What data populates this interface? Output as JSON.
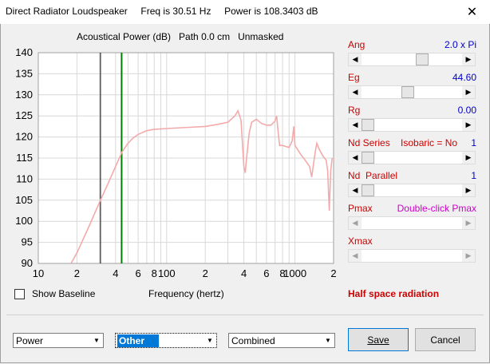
{
  "window": {
    "title": "Direct Radiator Loudspeaker     Freq is 30.51 Hz     Power is 108.3403 dB",
    "close_glyph": "✕"
  },
  "plot": {
    "title": "Acoustical Power (dB)   Path 0.0 cm   Unmasked",
    "xlabel": "Frequency (hertz)",
    "show_baseline_label": "Show Baseline",
    "half_space_label": "Half space radiation"
  },
  "chart_data": {
    "type": "line",
    "title": "Acoustical Power (dB)   Path 0.0 cm   Unmasked",
    "xlabel": "Frequency (hertz)",
    "ylabel": "",
    "x_scale": "log",
    "xlim": [
      10,
      2000
    ],
    "ylim": [
      90,
      140
    ],
    "grid": true,
    "y_ticks": [
      90,
      95,
      100,
      105,
      110,
      115,
      120,
      125,
      130,
      135,
      140
    ],
    "x_ticks": [
      {
        "v": 10,
        "label": "10"
      },
      {
        "v": 20,
        "label": "2"
      },
      {
        "v": 40,
        "label": "4"
      },
      {
        "v": 60,
        "label": "6"
      },
      {
        "v": 80,
        "label": "8"
      },
      {
        "v": 100,
        "label": "100"
      },
      {
        "v": 200,
        "label": "2"
      },
      {
        "v": 400,
        "label": "4"
      },
      {
        "v": 600,
        "label": "6"
      },
      {
        "v": 800,
        "label": "8"
      },
      {
        "v": 1000,
        "label": "1000"
      },
      {
        "v": 2000,
        "label": "2"
      }
    ],
    "markers": [
      {
        "x": 30.51,
        "color": "#000000"
      },
      {
        "x": 44.6,
        "color": "#008000"
      }
    ],
    "series": [
      {
        "color": "#f4aaaa",
        "points": [
          [
            18,
            90
          ],
          [
            20,
            92.5
          ],
          [
            25,
            99
          ],
          [
            30,
            104.5
          ],
          [
            35,
            109
          ],
          [
            40,
            113
          ],
          [
            45,
            116.5
          ],
          [
            50,
            118.5
          ],
          [
            55,
            119.8
          ],
          [
            60,
            120.6
          ],
          [
            70,
            121.5
          ],
          [
            80,
            121.8
          ],
          [
            100,
            122
          ],
          [
            150,
            122.3
          ],
          [
            200,
            122.5
          ],
          [
            250,
            123
          ],
          [
            300,
            123.5
          ],
          [
            340,
            125
          ],
          [
            360,
            126.2
          ],
          [
            380,
            124
          ],
          [
            400,
            113
          ],
          [
            410,
            111.5
          ],
          [
            420,
            115
          ],
          [
            440,
            121
          ],
          [
            460,
            123.5
          ],
          [
            500,
            124.2
          ],
          [
            550,
            123.2
          ],
          [
            600,
            122.8
          ],
          [
            650,
            122.8
          ],
          [
            700,
            123.8
          ],
          [
            720,
            125
          ],
          [
            740,
            121
          ],
          [
            760,
            118
          ],
          [
            800,
            118
          ],
          [
            900,
            117.5
          ],
          [
            950,
            119
          ],
          [
            980,
            122.5
          ],
          [
            1000,
            118
          ],
          [
            1050,
            117
          ],
          [
            1100,
            116
          ],
          [
            1200,
            114.5
          ],
          [
            1300,
            113
          ],
          [
            1350,
            110.5
          ],
          [
            1400,
            114
          ],
          [
            1450,
            117
          ],
          [
            1480,
            118.5
          ],
          [
            1550,
            117
          ],
          [
            1650,
            115.5
          ],
          [
            1750,
            114.5
          ],
          [
            1800,
            112
          ],
          [
            1850,
            102.5
          ],
          [
            1900,
            112
          ],
          [
            1950,
            115
          ]
        ]
      }
    ]
  },
  "controls": [
    {
      "key": "ang",
      "label": "Ang",
      "value": "2.0 x Pi",
      "thumb": 0.62,
      "disabled": false
    },
    {
      "key": "eg",
      "label": "Eg",
      "value": "44.60",
      "thumb": 0.45,
      "disabled": false
    },
    {
      "key": "rg",
      "label": "Rg",
      "value": "0.00",
      "thumb": 0.0,
      "disabled": false
    },
    {
      "key": "nds",
      "label": "Nd Series    Isobaric = No",
      "value": "1",
      "thumb": 0.0,
      "disabled": false
    },
    {
      "key": "ndp",
      "label": "Nd  Parallel",
      "value": "1",
      "thumb": 0.0,
      "disabled": false
    },
    {
      "key": "pmax",
      "label": "Pmax",
      "value": "Double-click Pmax",
      "value_color": "#cc00cc",
      "thumb": null,
      "disabled": true
    },
    {
      "key": "xmax",
      "label": "Xmax",
      "value": "",
      "thumb": null,
      "disabled": true
    }
  ],
  "bottom": {
    "combo1": "Power",
    "combo2": "Other",
    "combo3": "Combined",
    "save": "Save",
    "cancel": "Cancel"
  },
  "icons": {
    "dropdown": "▼",
    "left_arrow": "◀",
    "right_arrow": "▶"
  }
}
